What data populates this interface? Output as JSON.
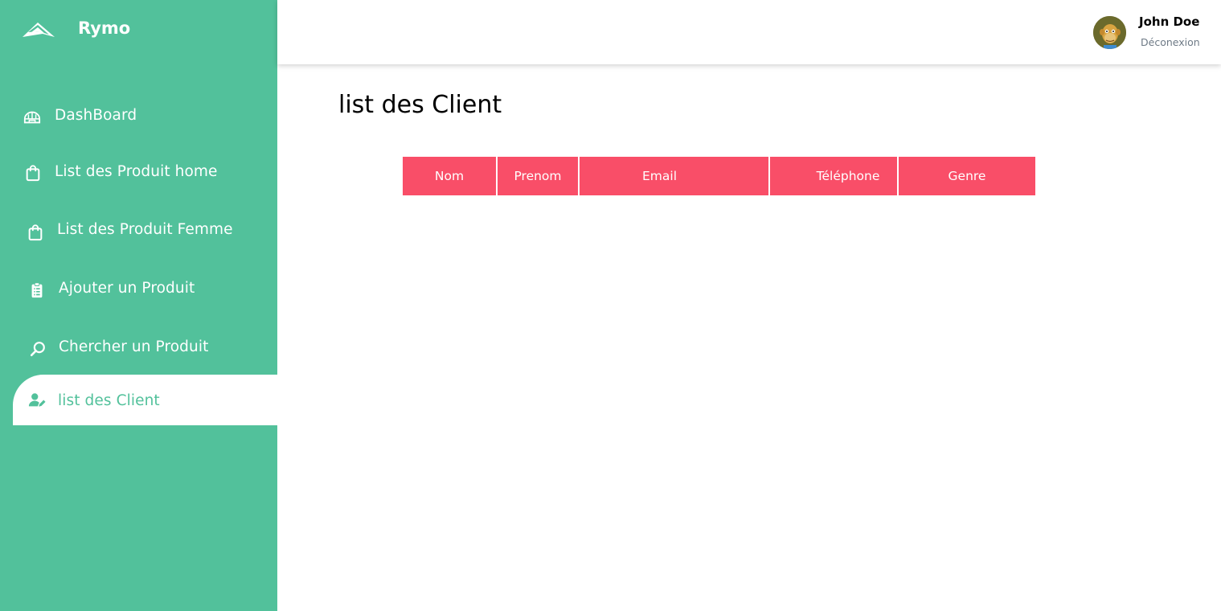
{
  "brand": {
    "name": "Rymo"
  },
  "sidebar": {
    "items": [
      {
        "label": "DashBoard",
        "icon": "igloo-icon",
        "active": false
      },
      {
        "label": "List des Produit home",
        "icon": "shopping-bag-icon",
        "active": false
      },
      {
        "label": "List des Produit Femme",
        "icon": "shopping-bag-icon",
        "active": false
      },
      {
        "label": "Ajouter un Produit",
        "icon": "clipboard-list-icon",
        "active": false
      },
      {
        "label": "Chercher un Produit",
        "icon": "search-icon",
        "active": false
      },
      {
        "label": "list des Client",
        "icon": "user-edit-icon",
        "active": true
      }
    ]
  },
  "header": {
    "user_name": "John Doe",
    "logout_label": "Déconexion",
    "avatar_icon": "ape-avatar-icon"
  },
  "main": {
    "title": "list des Client",
    "table": {
      "columns": [
        "Nom",
        "Prenom",
        "Email",
        "Téléphone",
        "Genre"
      ],
      "rows": []
    }
  },
  "colors": {
    "sidebar_bg": "#52c19b",
    "table_header_bg": "#f94e68",
    "active_text": "#52c19b",
    "logout_text": "#6e7a86"
  }
}
